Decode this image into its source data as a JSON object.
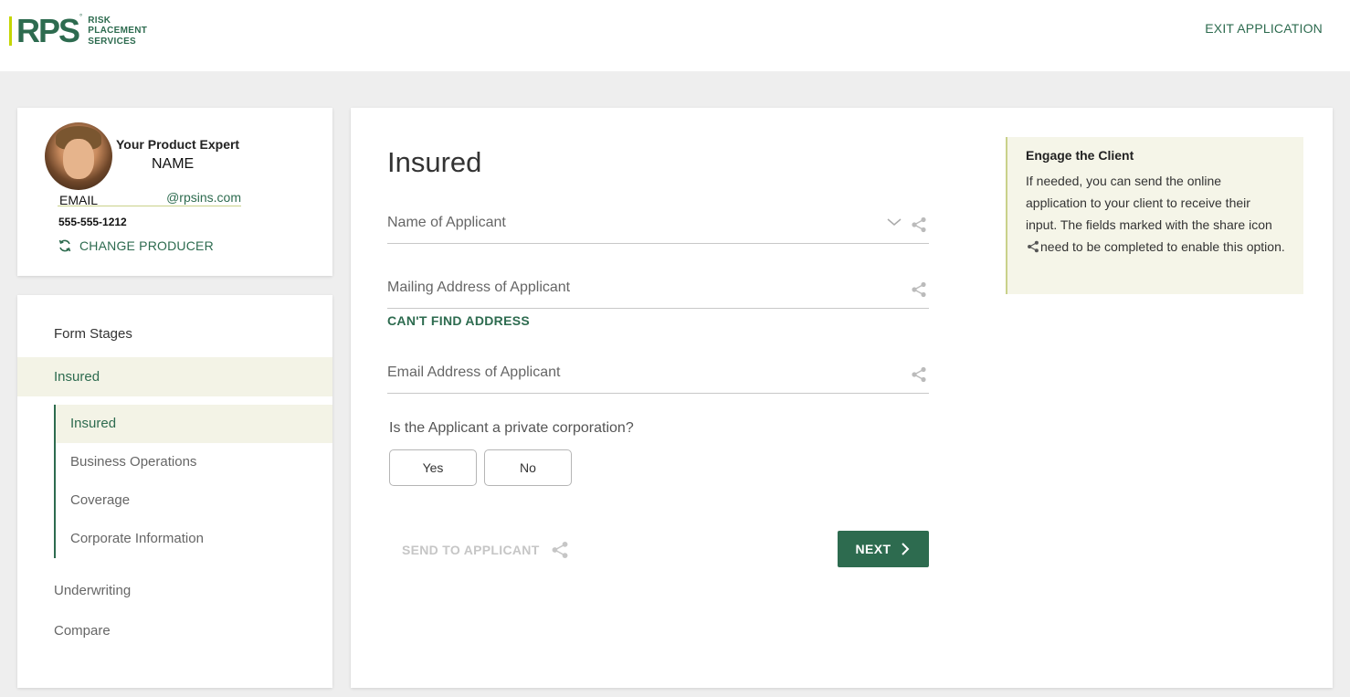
{
  "header": {
    "logo": {
      "mark": "RPS",
      "reg": "°",
      "lines": [
        "RISK",
        "PLACEMENT",
        "SERVICES"
      ]
    },
    "exit_label": "EXIT APPLICATION"
  },
  "producer": {
    "title": "Your Product Expert",
    "name": "NAME",
    "email_label": "EMAIL",
    "email_domain": "@rpsins.com",
    "phone": "555-555-1212",
    "change_label": "CHANGE PRODUCER"
  },
  "nav": {
    "heading": "Form Stages",
    "active_stage": "Insured",
    "substages": [
      "Insured",
      "Business Operations",
      "Coverage",
      "Corporate Information"
    ],
    "other_stages": [
      "Underwriting",
      "Compare"
    ]
  },
  "form": {
    "title": "Insured",
    "name_placeholder": "Name of Applicant",
    "mailing_placeholder": "Mailing Address of Applicant",
    "cant_find": "CAN'T FIND ADDRESS",
    "email_placeholder": "Email Address of Applicant",
    "question": "Is the Applicant a private corporation?",
    "yes_label": "Yes",
    "no_label": "No",
    "send_label": "SEND TO APPLICANT",
    "next_label": "NEXT"
  },
  "engage": {
    "title": "Engage the Client",
    "text_before_icon": "If needed, you can send the online application to your client to receive their input. The fields marked with the share icon",
    "text_after_icon": "need to be completed to enable this option."
  },
  "colors": {
    "brand_green": "#2d6b4f",
    "accent_lime": "#c4d600",
    "panel_bg": "#f5f5e8"
  }
}
